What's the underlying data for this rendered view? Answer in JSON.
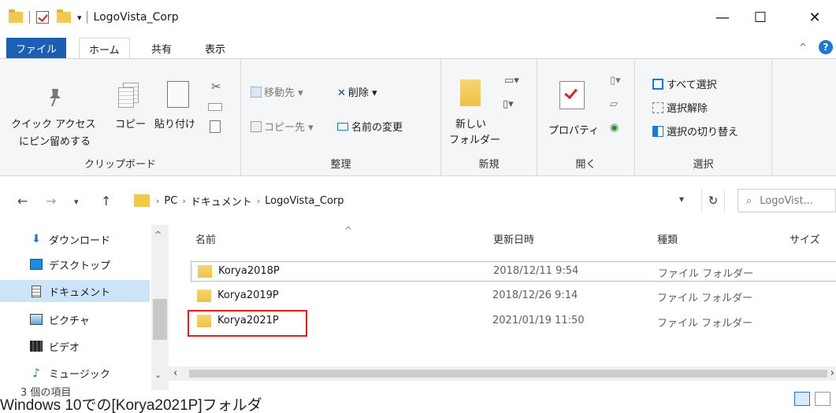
{
  "window": {
    "title": "LogoVista_Corp",
    "minimize": "—",
    "maximize": "☐",
    "close": "✕"
  },
  "tabs": [
    "ファイル",
    "ホーム",
    "共有",
    "表示"
  ],
  "ribbon": {
    "collapse": "^",
    "help": "?",
    "clipboard": {
      "label": "クリップボード",
      "pin_line1": "クイック アクセス",
      "pin_line2": "にピン留めする",
      "copy": "コピー",
      "paste": "貼り付け"
    },
    "organize": {
      "label": "整理",
      "move_to": "移動先",
      "copy_to": "コピー先",
      "delete": "削除",
      "rename": "名前の変更"
    },
    "new": {
      "label": "新規",
      "new_folder_line1": "新しい",
      "new_folder_line2": "フォルダー"
    },
    "open": {
      "label": "開く",
      "properties": "プロパティ"
    },
    "select": {
      "label": "選択",
      "select_all": "すべて選択",
      "select_none": "選択解除",
      "invert": "選択の切り替え"
    }
  },
  "address": {
    "crumbs": [
      "PC",
      "ドキュメント",
      "LogoVista_Corp"
    ],
    "search_placeholder": "LogoVist..."
  },
  "sidebar": {
    "items": [
      {
        "label": "ダウンロード",
        "icon": "download-icon"
      },
      {
        "label": "デスクトップ",
        "icon": "desktop-icon"
      },
      {
        "label": "ドキュメント",
        "icon": "documents-icon"
      },
      {
        "label": "ピクチャ",
        "icon": "pictures-icon"
      },
      {
        "label": "ビデオ",
        "icon": "videos-icon"
      },
      {
        "label": "ミュージック",
        "icon": "music-icon"
      }
    ]
  },
  "filelist": {
    "columns": [
      "名前",
      "更新日時",
      "種類",
      "サイズ"
    ],
    "rows": [
      {
        "name": "Korya2018P",
        "modified": "2018/12/11 9:54",
        "type": "ファイル フォルダー"
      },
      {
        "name": "Korya2019P",
        "modified": "2018/12/26 9:14",
        "type": "ファイル フォルダー"
      },
      {
        "name": "Korya2021P",
        "modified": "2021/01/19 11:50",
        "type": "ファイル フォルダー"
      }
    ]
  },
  "status": {
    "item_count": "3 個の項目"
  },
  "caption": "Windows 10での[Korya2021P]フォルダ",
  "colors": {
    "accent": "#1a78d6",
    "file_tab": "#1a5fb4",
    "folder": "#f2c94c",
    "highlight_box": "#e02020",
    "selected_nav": "#cce4f7"
  }
}
